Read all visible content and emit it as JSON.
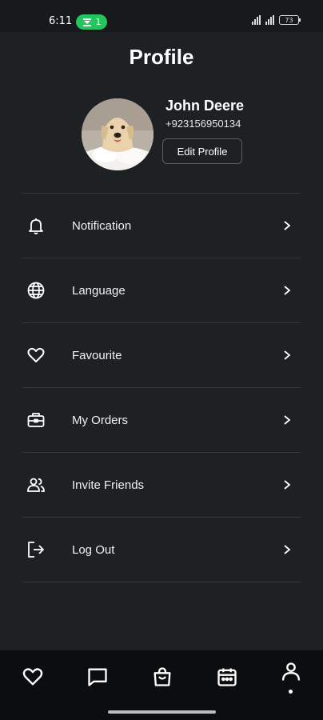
{
  "status_bar": {
    "time": "6:11",
    "call_count": "1",
    "battery": "73",
    "accent": "#22c55e"
  },
  "header": {
    "title": "Profile"
  },
  "profile": {
    "name": "John Deere",
    "phone": "+923156950134",
    "edit_label": "Edit Profile",
    "avatar_icon": "dog-photo"
  },
  "menu": {
    "items": [
      {
        "label": "Notification",
        "icon": "bell-icon"
      },
      {
        "label": "Language",
        "icon": "globe-icon"
      },
      {
        "label": "Favourite",
        "icon": "heart-icon"
      },
      {
        "label": "My Orders",
        "icon": "briefcase-icon"
      },
      {
        "label": "Invite Friends",
        "icon": "users-icon"
      },
      {
        "label": "Log Out",
        "icon": "logout-icon"
      }
    ]
  },
  "bottom_nav": {
    "items": [
      "heart-icon",
      "chat-icon",
      "shopping-bag-icon",
      "calendar-icon",
      "profile-icon"
    ],
    "active": "profile-icon"
  }
}
